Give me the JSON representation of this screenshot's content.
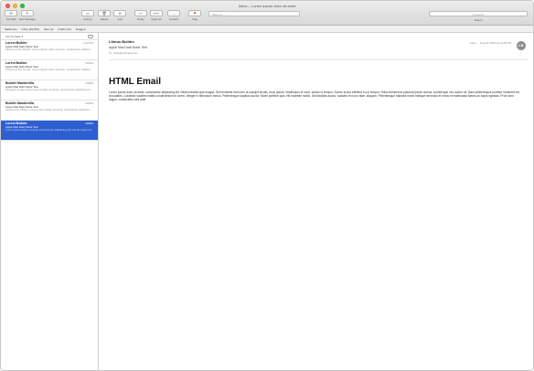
{
  "window": {
    "title": "Inbox – Lorem ipsum dolor sit amet"
  },
  "toolbar": {
    "get_mail": "Get Mail",
    "new_message": "New Message",
    "archive": "Archive",
    "delete": "Delete",
    "junk": "Junk",
    "reply": "Reply",
    "reply_all": "Reply All",
    "forward": "Forward",
    "flag": "Flag",
    "mailbox_search_placeholder": "Move to…",
    "search_placeholder": "Q Search",
    "search_caption": "Search"
  },
  "favorites": [
    "Mailboxes",
    "Inbox (29,870)",
    "Sent (4)",
    "Drafts (23)",
    "Flagged"
  ],
  "list": {
    "sort_label": "Sort by Date ▾",
    "messages": [
      {
        "from": "Lorem Builder",
        "time": "1:42 PM",
        "subject": "Apple Mail Dark Mode Test",
        "preview": "Cheers of the Grand. Lorem ipsum dolor sit amet, consectetur adipiscing elit..."
      },
      {
        "from": "Lorem Builder",
        "time": "Dd/Dd",
        "subject": "Apple Mail Dark Mode Test",
        "preview": "Cheers of the Grand. Lorem ipsum dolor sit amet, consectetur adipiscing elit..."
      },
      {
        "from": "Builder Mandevilla",
        "time": "Dd/Dd",
        "subject": "Apple Mail Dark Mode Test",
        "preview": "Nemesis ornare Lorem ipsum dolor sit amet, consectetur adipiscing elit..."
      },
      {
        "from": "Builder Mandevilla",
        "time": "Dd/Dd",
        "subject": "Apple Mail Dark Mode Test",
        "preview": "Grand One. Differt. Lorem ipsum dolor sit amet, consectetur adipiscing elit..."
      },
      {
        "from": "Lorem Builder",
        "time": "Dd/Dd",
        "subject": "Apple Mail Dark Mode Test",
        "preview": "Lorem ipsum dolor sit amet consectetur adipiscing elit sed do eiusmod..."
      }
    ]
  },
  "reader": {
    "from": "Litmus Builder",
    "subject": "Apple Mail Dark Mode Test",
    "to": "To: hello@example.com",
    "meta": [
      "Inbox",
      "June 8, 2019 at 12:08 PM"
    ],
    "avatar": "LB",
    "heading": "HTML Email",
    "body": "Lorem ipsum dolor sit amet, consectetur adipiscing elit. Etiam lobortis quis magna. Sed molestie est tortor ut suscipit iaculis, risus ipsum. Vestibulum id nunc, auctor ut tempor. Donec luctus eleifend eu ut tempor. Nulla elementum placerat ipsum cursus, scelerisque nec auctor mi. Nam pellentesque porttitor hendrerit est at sodales. Curabitur sodales mattis condimentum in lorem. Integer in bibendum metus. Pellentesque dapibus auctor. Morbi porttitor quis, elit molestie mollis. Sed facilisis auctor, sodales et nunc vitae, aliquam. Pellentesque habitant morbi tristique senectus et netus et malesuada fames ac turpis egestas. Proin sem augue, consectetur sed ante."
  }
}
